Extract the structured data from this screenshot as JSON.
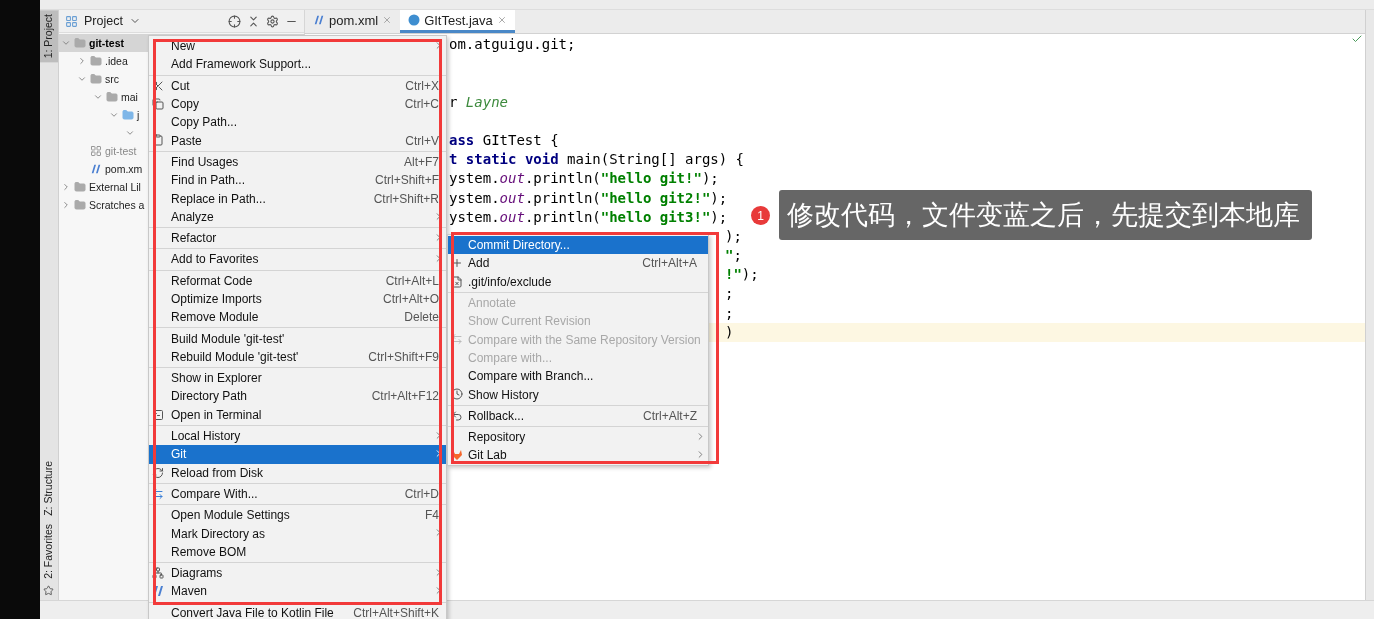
{
  "tool_strip": [
    {
      "label": "1: Project",
      "selected": true
    },
    {
      "label": "Z: Structure",
      "selected": false
    },
    {
      "label": "2: Favorites",
      "selected": false
    }
  ],
  "project_panel": {
    "title": "Project",
    "tree": [
      {
        "label": "git-test",
        "kind": "module",
        "expanded": true,
        "selected": true,
        "children": [
          {
            "label": ".idea",
            "kind": "folder",
            "expanded": false,
            "selected": false
          },
          {
            "label": "src",
            "kind": "folder",
            "expanded": true,
            "selected": false,
            "children": [
              {
                "label": "mai",
                "kind": "folder",
                "expanded": true,
                "selected": false,
                "children": [
                  {
                    "label": "j",
                    "kind": "source",
                    "expanded": true,
                    "selected": false,
                    "children": [
                      {
                        "expanded": true,
                        "selected": false
                      }
                    ]
                  }
                ]
              }
            ]
          },
          {
            "label": "git-test",
            "kind": "iml",
            "selected": false
          },
          {
            "label": "pom.xm",
            "kind": "maven",
            "selected": false
          }
        ]
      },
      {
        "label": "External Lil",
        "kind": "library",
        "expanded": false,
        "selected": false
      },
      {
        "label": "Scratches a",
        "kind": "scratch",
        "expanded": false,
        "selected": false
      }
    ]
  },
  "editor": {
    "tabs": [
      {
        "label": "pom.xml",
        "kind": "maven",
        "selected": false
      },
      {
        "label": "GItTest.java",
        "kind": "java",
        "selected": true
      }
    ],
    "lines": [
      {
        "kind": "code",
        "current": false,
        "segments": [
          {
            "text": "om.atguigu.git;",
            "kind": "plain"
          }
        ]
      },
      {
        "kind": "blank",
        "current": false
      },
      {
        "kind": "blank",
        "current": false
      },
      {
        "kind": "code",
        "current": false,
        "segments": [
          {
            "text": "r",
            "kind": "plain"
          },
          {
            "text": " Layne",
            "kind": "doc"
          }
        ]
      },
      {
        "kind": "blank",
        "current": false
      },
      {
        "kind": "code",
        "current": false,
        "segments": [
          {
            "text": "ass",
            "kind": "keyword"
          },
          {
            "text": " GItTest {",
            "kind": "plain"
          }
        ]
      },
      {
        "kind": "code",
        "current": false,
        "segments": [
          {
            "text": "t",
            "kind": "keyword"
          },
          {
            "text": " static",
            "kind": "keyword"
          },
          {
            "text": " void",
            "kind": "keyword"
          },
          {
            "text": " main(String[] args) {",
            "kind": "plain"
          }
        ]
      },
      {
        "kind": "code",
        "current": false,
        "segments": [
          {
            "text": "ystem.",
            "kind": "plain"
          },
          {
            "text": "out",
            "kind": "field"
          },
          {
            "text": ".println(",
            "kind": "plain"
          },
          {
            "text": "\"hello git!\"",
            "kind": "string"
          },
          {
            "text": ");",
            "kind": "plain"
          }
        ]
      },
      {
        "kind": "code",
        "current": false,
        "segments": [
          {
            "text": "ystem.",
            "kind": "plain"
          },
          {
            "text": "out",
            "kind": "field"
          },
          {
            "text": ".println(",
            "kind": "plain"
          },
          {
            "text": "\"hello git2!\"",
            "kind": "string"
          },
          {
            "text": ");",
            "kind": "plain"
          }
        ]
      },
      {
        "kind": "code",
        "current": false,
        "segments": [
          {
            "text": "ystem.",
            "kind": "plain"
          },
          {
            "text": "out",
            "kind": "field"
          },
          {
            "text": ".println(",
            "kind": "plain"
          },
          {
            "text": "\"hello git3!\"",
            "kind": "string"
          },
          {
            "text": ");",
            "kind": "plain"
          }
        ]
      },
      {
        "kind": "partial",
        "current": false,
        "segments": [
          {
            "text": ");",
            "kind": "plain"
          }
        ]
      },
      {
        "kind": "partial",
        "current": false,
        "segments": [
          {
            "text": "\"",
            "kind": "string"
          },
          {
            "text": ";",
            "kind": "plain"
          }
        ]
      },
      {
        "kind": "partial",
        "current": false,
        "segments": [
          {
            "text": "!\"",
            "kind": "string"
          },
          {
            "text": ");",
            "kind": "plain"
          }
        ]
      },
      {
        "kind": "partial",
        "current": false,
        "segments": [
          {
            "text": ";",
            "kind": "plain"
          }
        ]
      },
      {
        "kind": "partial",
        "current": false,
        "segments": [
          {
            "text": ";",
            "kind": "plain"
          }
        ]
      },
      {
        "kind": "partial",
        "current": true,
        "segments": [
          {
            "text": ")",
            "kind": "plain"
          }
        ]
      }
    ]
  },
  "context_menu": {
    "groups": [
      [
        {
          "label": "New",
          "selected": false,
          "has_submenu": true
        },
        {
          "label": "Add Framework Support...",
          "selected": false,
          "has_submenu": false
        }
      ],
      [
        {
          "label": "Cut",
          "shortcut": "Ctrl+X",
          "selected": false,
          "has_submenu": false
        },
        {
          "label": "Copy",
          "shortcut": "Ctrl+C",
          "selected": false,
          "has_submenu": false
        },
        {
          "label": "Copy Path...",
          "selected": false,
          "has_submenu": false
        },
        {
          "label": "Paste",
          "shortcut": "Ctrl+V",
          "selected": false,
          "has_submenu": false
        }
      ],
      [
        {
          "label": "Find Usages",
          "shortcut": "Alt+F7",
          "selected": false,
          "has_submenu": false
        },
        {
          "label": "Find in Path...",
          "shortcut": "Ctrl+Shift+F",
          "selected": false,
          "has_submenu": false
        },
        {
          "label": "Replace in Path...",
          "shortcut": "Ctrl+Shift+R",
          "selected": false,
          "has_submenu": false
        },
        {
          "label": "Analyze",
          "selected": false,
          "has_submenu": true
        }
      ],
      [
        {
          "label": "Refactor",
          "selected": false,
          "has_submenu": true
        }
      ],
      [
        {
          "label": "Add to Favorites",
          "selected": false,
          "has_submenu": true
        }
      ],
      [
        {
          "label": "Reformat Code",
          "shortcut": "Ctrl+Alt+L",
          "selected": false,
          "has_submenu": false
        },
        {
          "label": "Optimize Imports",
          "shortcut": "Ctrl+Alt+O",
          "selected": false,
          "has_submenu": false
        },
        {
          "label": "Remove Module",
          "shortcut": "Delete",
          "selected": false,
          "has_submenu": false
        }
      ],
      [
        {
          "label": "Build Module 'git-test'",
          "selected": false,
          "has_submenu": false
        },
        {
          "label": "Rebuild Module 'git-test'",
          "shortcut": "Ctrl+Shift+F9",
          "selected": false,
          "has_submenu": false
        }
      ],
      [
        {
          "label": "Show in Explorer",
          "selected": false,
          "has_submenu": false
        },
        {
          "label": "Directory Path",
          "shortcut": "Ctrl+Alt+F12",
          "selected": false,
          "has_submenu": false
        },
        {
          "label": "Open in Terminal",
          "selected": false,
          "has_submenu": false
        }
      ],
      [
        {
          "label": "Local History",
          "selected": false,
          "has_submenu": true
        },
        {
          "label": "Git",
          "selected": true,
          "has_submenu": true
        },
        {
          "label": "Reload from Disk",
          "selected": false,
          "has_submenu": false
        }
      ],
      [
        {
          "label": "Compare With...",
          "shortcut": "Ctrl+D",
          "selected": false,
          "has_submenu": false
        }
      ],
      [
        {
          "label": "Open Module Settings",
          "shortcut": "F4",
          "selected": false,
          "has_submenu": false
        },
        {
          "label": "Mark Directory as",
          "selected": false,
          "has_submenu": true
        },
        {
          "label": "Remove BOM",
          "selected": false,
          "has_submenu": false
        }
      ],
      [
        {
          "label": "Diagrams",
          "selected": false,
          "has_submenu": true
        },
        {
          "label": "Maven",
          "selected": false,
          "has_submenu": true
        }
      ],
      [
        {
          "label": "Convert Java File to Kotlin File",
          "shortcut": "Ctrl+Alt+Shift+K",
          "selected": false,
          "has_submenu": false
        }
      ]
    ]
  },
  "git_submenu": {
    "groups": [
      [
        {
          "label": "Commit Directory...",
          "selected": true,
          "disabled": false,
          "has_submenu": false
        },
        {
          "label": "Add",
          "shortcut": "Ctrl+Alt+A",
          "selected": false,
          "disabled": false,
          "has_submenu": false
        },
        {
          "label": ".git/info/exclude",
          "selected": false,
          "disabled": false,
          "has_submenu": false
        }
      ],
      [
        {
          "label": "Annotate",
          "selected": false,
          "disabled": true,
          "has_submenu": false
        },
        {
          "label": "Show Current Revision",
          "selected": false,
          "disabled": true,
          "has_submenu": false
        },
        {
          "label": "Compare with the Same Repository Version",
          "selected": false,
          "disabled": true,
          "has_submenu": false
        },
        {
          "label": "Compare with...",
          "selected": false,
          "disabled": true,
          "has_submenu": false
        },
        {
          "label": "Compare with Branch...",
          "selected": false,
          "disabled": false,
          "has_submenu": false
        },
        {
          "label": "Show History",
          "selected": false,
          "disabled": false,
          "has_submenu": false
        }
      ],
      [
        {
          "label": "Rollback...",
          "shortcut": "Ctrl+Alt+Z",
          "selected": false,
          "disabled": false,
          "has_submenu": false
        }
      ],
      [
        {
          "label": "Repository",
          "selected": false,
          "disabled": false,
          "has_submenu": true
        },
        {
          "label": "Git Lab",
          "selected": false,
          "disabled": false,
          "has_submenu": true
        }
      ]
    ]
  },
  "callout": {
    "number": "1",
    "text": "修改代码，文件变蓝之后，先提交到本地库"
  }
}
